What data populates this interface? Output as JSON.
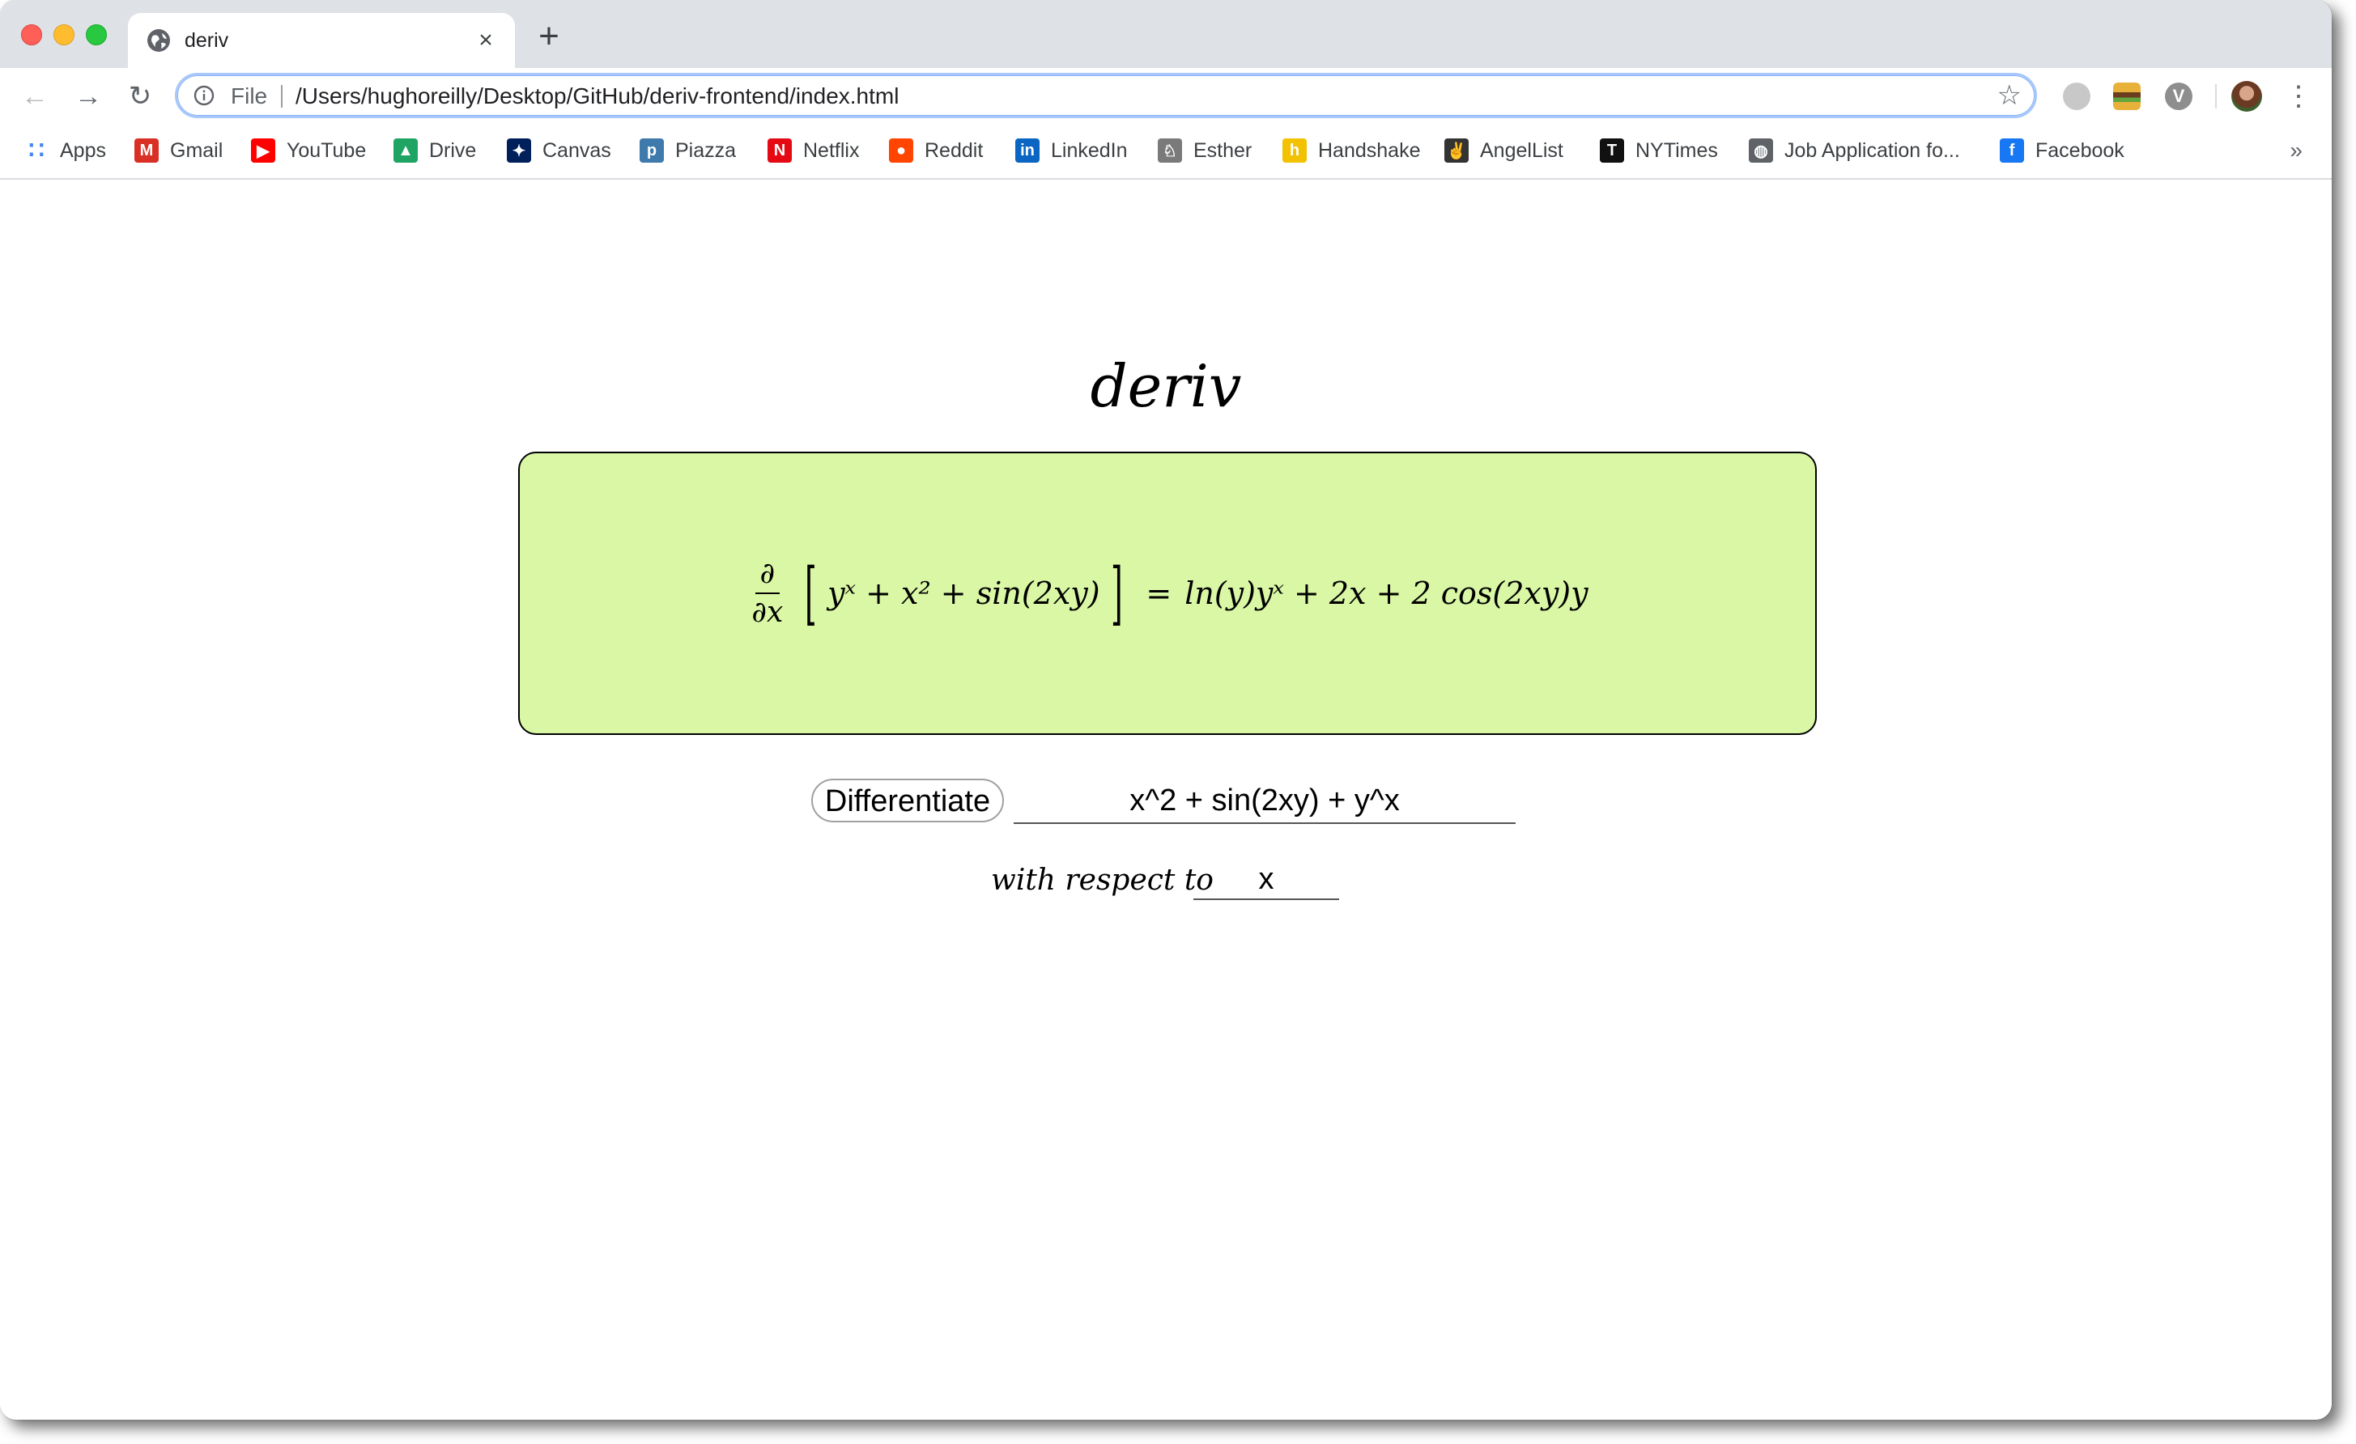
{
  "browser": {
    "tab": {
      "title": "deriv",
      "close_glyph": "×"
    },
    "new_tab_glyph": "+",
    "nav": {
      "back_glyph": "←",
      "forward_glyph": "→",
      "reload_glyph": "↻"
    },
    "address_bar": {
      "scheme_label": "File",
      "url": "/Users/hughoreilly/Desktop/GitHub/deriv-frontend/index.html",
      "star_glyph": "☆"
    },
    "extensions": [
      "circle-extension-icon",
      "burger-extension-icon",
      "v-extension-icon"
    ],
    "extension_v_label": "V",
    "menu_glyph": "⋮",
    "bookmarks": [
      {
        "label": "Apps",
        "icon": "apps-grid-icon",
        "color": "#4285f4",
        "glyph": "∷"
      },
      {
        "label": "Gmail",
        "icon": "gmail-icon",
        "color": "#d93025",
        "glyph": "M"
      },
      {
        "label": "YouTube",
        "icon": "youtube-icon",
        "color": "#ff0000",
        "glyph": "▶"
      },
      {
        "label": "Drive",
        "icon": "drive-icon",
        "color": "#1fa463",
        "glyph": "▲"
      },
      {
        "label": "Canvas",
        "icon": "canvas-icon",
        "color": "#00205b",
        "glyph": "✦"
      },
      {
        "label": "Piazza",
        "icon": "piazza-icon",
        "color": "#3e7aab",
        "glyph": "p"
      },
      {
        "label": "Netflix",
        "icon": "netflix-icon",
        "color": "#e50914",
        "glyph": "N"
      },
      {
        "label": "Reddit",
        "icon": "reddit-icon",
        "color": "#ff4500",
        "glyph": "●"
      },
      {
        "label": "LinkedIn",
        "icon": "linkedin-icon",
        "color": "#0a66c2",
        "glyph": "in"
      },
      {
        "label": "Esther",
        "icon": "esther-icon",
        "color": "#7a7a7a",
        "glyph": "♘"
      },
      {
        "label": "Handshake",
        "icon": "handshake-icon",
        "color": "#f2c200",
        "glyph": "h"
      },
      {
        "label": "AngelList",
        "icon": "angellist-icon",
        "color": "#333333",
        "glyph": "✌"
      },
      {
        "label": "NYTimes",
        "icon": "nytimes-icon",
        "color": "#111111",
        "glyph": "T"
      },
      {
        "label": "Job Application fo...",
        "icon": "globe-icon",
        "color": "#5f6368",
        "glyph": "◍"
      },
      {
        "label": "Facebook",
        "icon": "facebook-icon",
        "color": "#1877f2",
        "glyph": "f"
      }
    ],
    "bookmarks_overflow_glyph": "»"
  },
  "page": {
    "title": "deriv",
    "result": {
      "operator_num": "∂",
      "operator_den": "∂x",
      "input_expr": "yˣ + x² + sin(2xy)",
      "equals": "=",
      "derivative": "ln(y)yˣ + 2x + 2 cos(2xy)y",
      "background_color": "#d9f7a5"
    },
    "differentiate_button": "Differentiate",
    "expression_input_value": "x^2 + sin(2xy) + y^x",
    "wrt_label": "with respect to",
    "variable_input_value": "x"
  }
}
